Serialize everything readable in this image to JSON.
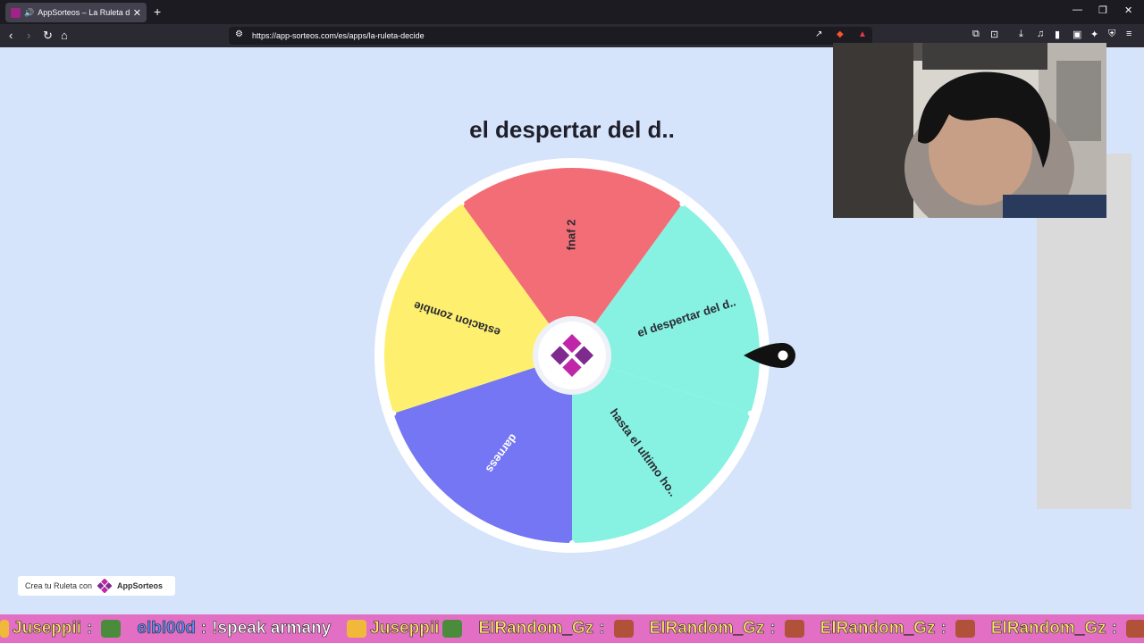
{
  "browser": {
    "tab_title": "AppSorteos – La Ruleta de la",
    "url": "https://app-sorteos.com/es/apps/la-ruleta-decide"
  },
  "wheel": {
    "title": "el despertar del d..",
    "segments": [
      {
        "label": "fnaf 2",
        "color": "#f26d76"
      },
      {
        "label": "el despertar del d..",
        "color": "#87f2e2"
      },
      {
        "label": "hasta el ultimo ho..",
        "color": "#87f2e2"
      },
      {
        "label": "darness",
        "color": "#7476f3"
      },
      {
        "label": "estacion zombie",
        "color": "#fef06e"
      }
    ]
  },
  "brand": {
    "prefix": "Crea tu Ruleta con",
    "name": "AppSorteos"
  },
  "chat": [
    {
      "user": "Juseppii",
      "text": ""
    },
    {
      "user": "elbl00d",
      "text": "!speak armany"
    },
    {
      "user": "Juseppii",
      "text": ""
    },
    {
      "user": "ElRandom_Gz",
      "text": ""
    },
    {
      "user": "ElRandom_Gz",
      "text": ""
    },
    {
      "user": "ElRandom_Gz",
      "text": ""
    },
    {
      "user": "ElRandom_Gz",
      "text": ""
    }
  ]
}
